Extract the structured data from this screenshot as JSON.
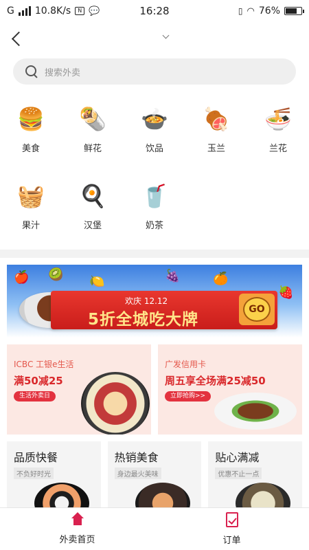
{
  "status_bar": {
    "carrier": "G",
    "speed": "10.8K/s",
    "time": "16:28",
    "battery": "76%",
    "battery_level": 0.76
  },
  "search": {
    "placeholder": "搜索外卖"
  },
  "categories": [
    {
      "label": "美食",
      "icon": "burger-icon"
    },
    {
      "label": "鲜花",
      "icon": "wrap-icon"
    },
    {
      "label": "饮品",
      "icon": "hotpot-icon"
    },
    {
      "label": "玉兰",
      "icon": "meat-icon"
    },
    {
      "label": "兰花",
      "icon": "noodle-bowl-icon"
    },
    {
      "label": "果汁",
      "icon": "fruit-basket-icon"
    },
    {
      "label": "汉堡",
      "icon": "bibimbap-icon"
    },
    {
      "label": "奶茶",
      "icon": "milkshake-icon"
    }
  ],
  "banner": {
    "subtitle": "欢庆 12.12",
    "title": "5折全城吃大牌",
    "button": "GO"
  },
  "promos": [
    {
      "brand": "ICBC 工银e生活",
      "offer": "满50减25",
      "button": "生活外卖日"
    },
    {
      "brand": "广发信用卡",
      "offer": "周五享全场满25减50",
      "button": "立即抢购>>"
    }
  ],
  "features": [
    {
      "title": "品质快餐",
      "subtitle": "不负好时光"
    },
    {
      "title": "热销美食",
      "subtitle": "身边最火美味"
    },
    {
      "title": "贴心满减",
      "subtitle": "优惠不止一点"
    }
  ],
  "tabs": [
    {
      "label": "外卖首页",
      "icon": "home-icon"
    },
    {
      "label": "订单",
      "icon": "order-icon"
    }
  ],
  "colors": {
    "accent": "#d9214f",
    "banner_red": "#e9372e",
    "promo_bg": "#fce8e3"
  }
}
